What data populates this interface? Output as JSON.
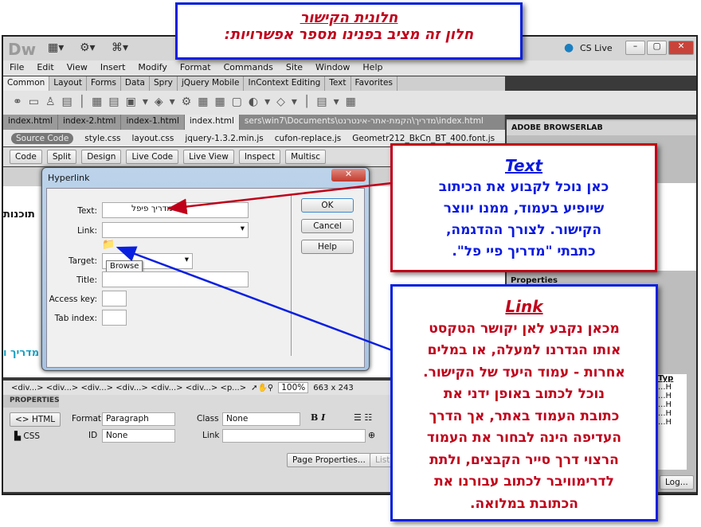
{
  "app": {
    "logo": "Dw",
    "cs_live": "CS Live"
  },
  "menu": [
    "File",
    "Edit",
    "View",
    "Insert",
    "Modify",
    "Format",
    "Commands",
    "Site",
    "Window",
    "Help"
  ],
  "insert_tabs": [
    "Common",
    "Layout",
    "Forms",
    "Data",
    "Spry",
    "jQuery Mobile",
    "InContext Editing",
    "Text",
    "Favorites"
  ],
  "doc_tabs": [
    "index.html",
    "index-2.html",
    "index-1.html",
    "index.html"
  ],
  "doc_path": "sers\\win7\\Documents\\מדריך\\הקמת-אתר-אינטרנט\\index.html",
  "related": {
    "source": "Source Code",
    "files": [
      "style.css",
      "layout.css",
      "jquery-1.3.2.min.js",
      "cufon-replace.js",
      "Geometr212_BkCn_BT_400.font.js"
    ]
  },
  "doc_toolbar": [
    "Code",
    "Split",
    "Design",
    "Live Code",
    "Live View",
    "Inspect",
    "Multisc"
  ],
  "design_text": {
    "t1": "תוכנות",
    "t2": "מדריך ו"
  },
  "status": {
    "tags": "<div...> <div...> <div...> <div...> <div...> <div...> <p...>",
    "zoom": "100%",
    "size": "663 x 243"
  },
  "properties": {
    "tab": "PROPERTIES",
    "html": "HTML",
    "css": "CSS",
    "format_label": "Format",
    "format_value": "Paragraph",
    "id_label": "ID",
    "id_value": "None",
    "class_label": "Class",
    "class_value": "None",
    "link_label": "Link",
    "page_props": "Page Properties...",
    "list": "List"
  },
  "right_panel": {
    "browserlab": "ADOBE BROWSERLAB",
    "properties": "Properties",
    "typ": "Typ",
    "rows": [
      "...H",
      "...H",
      "...H",
      "...H",
      "...H"
    ],
    "log": "Log..."
  },
  "dialog": {
    "title": "Hyperlink",
    "text_label": "Text:",
    "text_value": "מדריך פיפל",
    "link_label": "Link:",
    "target_label": "Target:",
    "title_label": "Title:",
    "access_label": "Access key:",
    "tab_label": "Tab index:",
    "ok": "OK",
    "cancel": "Cancel",
    "help": "Help",
    "tooltip": "Browse"
  },
  "callouts": {
    "top": {
      "line1": "חלונית הקישור",
      "line2": "חלון זה מציב בפנינו מספר אפשרויות:"
    },
    "text": {
      "title": "Text",
      "lines": [
        "כאן נוכל לקבוע את הכיתוב",
        "שיופיע בעמוד, ממנו יווצר",
        "הקישור. לצורך ההדגמה,",
        "כתבתי \"מדריך פיי פל\"."
      ]
    },
    "link": {
      "title": "Link",
      "lines": [
        "מכאן נקבע לאן יקושר הטקסט",
        "אותו הגדרנו למעלה, או במלים",
        "אחרות - עמוד היעד של הקישור.",
        "נוכל לכתוב באופן ידני את",
        "כתובת העמוד באתר, אך הדרך",
        "העדיפה הינה לבחור את העמוד",
        "הרצוי דרך סייר הקבצים, ולתת",
        "לדרימוויבר לכתוב עבורנו את",
        "הכתובת במלואה."
      ]
    }
  },
  "colors": {
    "red": "#c0001a",
    "blue": "#0a20e0"
  }
}
